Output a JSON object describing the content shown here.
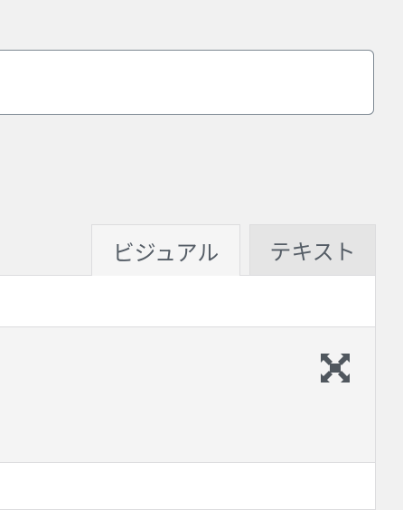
{
  "title_field": {
    "value": "",
    "placeholder": ""
  },
  "editor_tabs": [
    {
      "label": "ビジュアル",
      "active": true
    },
    {
      "label": "テキスト",
      "active": false
    }
  ],
  "toolbar": {
    "fullscreen_icon": "expand-icon"
  },
  "colors": {
    "background": "#f1f1f1",
    "border": "#dcdcde",
    "icon": "#50575e",
    "tab_text": "#555d66"
  }
}
